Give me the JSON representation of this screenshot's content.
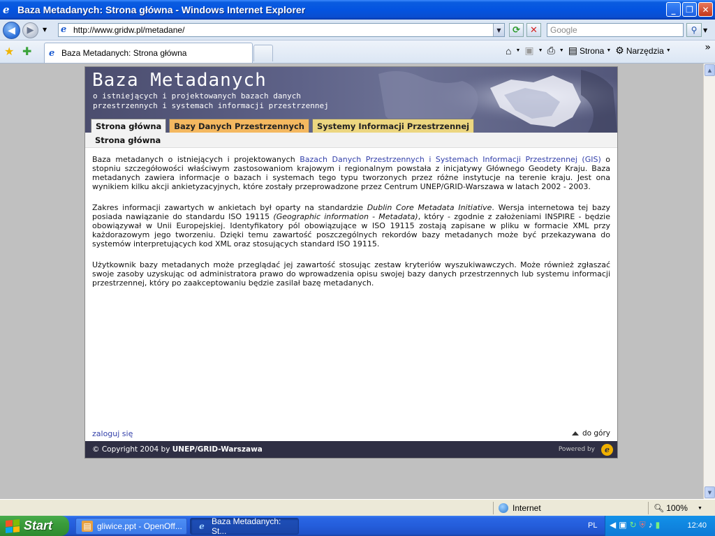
{
  "window": {
    "title": "Baza Metadanych: Strona główna - Windows Internet Explorer",
    "minimize_label": "_",
    "maximize_label": "❐",
    "close_label": "✕"
  },
  "navbar": {
    "address": "http://www.gridw.pl/metadane/",
    "search_placeholder": "Google"
  },
  "cmdbar": {
    "tab_label": "Baza Metadanych: Strona główna",
    "page_menu": "Strona",
    "tools_menu": "Narzędzia"
  },
  "page": {
    "title": "Baza Metadanych",
    "subtitle": "o istniejących i projektowanych bazach danych\nprzestrzennych i systemach informacji przestrzennej",
    "tabs": [
      {
        "label": "Strona główna"
      },
      {
        "label": "Bazy Danych Przestrzennych"
      },
      {
        "label": "Systemy Informacji Przestrzennej"
      }
    ],
    "breadcrumb": "Strona główna",
    "p1_before": "Baza metadanych o istniejących i projektowanych ",
    "p1_link": "Bazach Danych Przestrzennych i Systemach Informacji Przestrzennej (GIS)",
    "p1_after": " o stopniu szczegółowości właściwym zastosowaniom krajowym i regionalnym powstała z inicjatywy Głównego Geodety Kraju. Baza metadanych zawiera informacje o bazach i systemach tego typu tworzonych przez różne instytucje na terenie kraju. Jest ona wynikiem kilku akcji ankietyzacyjnych, które zostały przeprowadzone przez Centrum UNEP/GRID-Warszawa w latach 2002 - 2003.",
    "p2_a": "Zakres informacji zawartych w ankietach był oparty na standardzie ",
    "p2_em1": "Dublin Core Metadata Initiative",
    "p2_b": ". Wersja internetowa tej bazy posiada nawiązanie do standardu ISO 19115 ",
    "p2_em2": "(Geographic information - Metadata)",
    "p2_c": ", który - zgodnie z założeniami INSPIRE - będzie obowiązywał w Unii Europejskiej. Identyfikatory pól obowiązujące w ISO 19115 zostają zapisane w pliku w formacie XML przy każdorazowym jego tworzeniu. Dzięki temu zawartość poszczególnych rekordów bazy metadanych może być przekazywana do systemów interpretujących kod XML oraz stosujących standard ISO 19115.",
    "p3": "Użytkownik bazy metadanych może przeglądać jej zawartość stosując zestaw kryteriów wyszukiwawczych. Może również zgłaszać swoje zasoby uzyskując od administratora prawo do wprowadzenia opisu swojej bazy danych przestrzennych lub systemu informacji przestrzennej, który po zaakceptowaniu będzie zasilał bazę metadanych.",
    "login_link": "zaloguj się",
    "top_link": "do góry",
    "copyright_prefix": "© Copyright 2004 by ",
    "copyright_org": "UNEP/GRID-Warszawa",
    "powered_by": "Powered by"
  },
  "statusbar": {
    "zone": "Internet",
    "zoom": "100%"
  },
  "taskbar": {
    "start_label": "Start",
    "tasks": [
      {
        "label": "gliwice.ppt - OpenOff..."
      },
      {
        "label": "Baza Metadanych: St..."
      }
    ],
    "language": "PL",
    "clock": "12:40"
  }
}
